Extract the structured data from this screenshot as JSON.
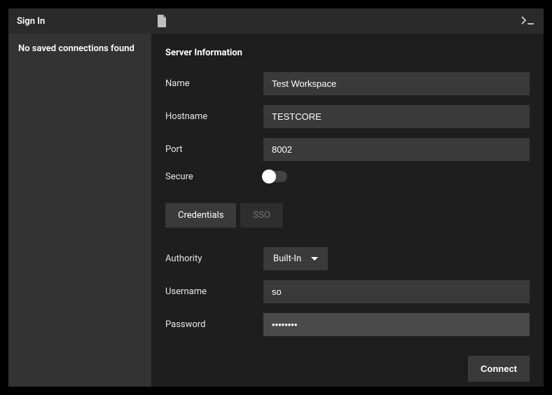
{
  "header": {
    "title": "Sign In"
  },
  "sidebar": {
    "empty_text": "No saved connections found"
  },
  "section": {
    "title": "Server Information"
  },
  "labels": {
    "name": "Name",
    "hostname": "Hostname",
    "port": "Port",
    "secure": "Secure",
    "authority": "Authority",
    "username": "Username",
    "password": "Password"
  },
  "fields": {
    "name": "Test Workspace",
    "hostname": "TESTCORE",
    "port": "8002",
    "secure": false,
    "authority": "Built-In",
    "username": "so",
    "password": "••••••••"
  },
  "tabs": {
    "credentials": "Credentials",
    "sso": "SSO"
  },
  "buttons": {
    "connect": "Connect"
  }
}
